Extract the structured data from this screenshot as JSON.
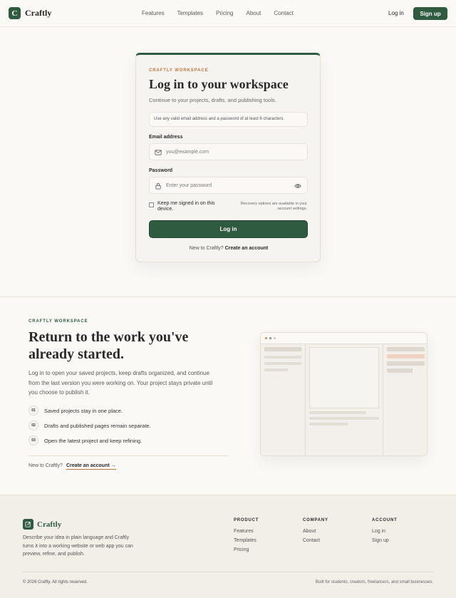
{
  "nav": {
    "logo_letter": "C",
    "brand": "Craftly",
    "links": [
      "Features",
      "Templates",
      "Pricing",
      "About",
      "Contact"
    ],
    "login": "Log in",
    "signup": "Sign up"
  },
  "login_card": {
    "eyebrow": "CRAFTLY WORKSPACE",
    "title": "Log in to your workspace",
    "subtitle": "Continue to your projects, drafts, and publishing tools.",
    "hint": "Use any valid email address and a password of at least 6 characters.",
    "email_label": "Email address",
    "email_placeholder": "you@example.com",
    "password_label": "Password",
    "password_placeholder": "Enter your password",
    "remember_label": "Keep me signed in on this device.",
    "recovery_note": "Recovery options are available in your account settings.",
    "submit": "Log in",
    "new_prefix": "New to Craftly?",
    "create_link": "Create an account"
  },
  "section": {
    "eyebrow": "CRAFTLY WORKSPACE",
    "title": "Return to the work you've already started.",
    "body": "Log in to open your saved projects, keep drafts organized, and continue from the last version you were working on. Your project stays private until you choose to publish it.",
    "steps": [
      {
        "num": "01",
        "text": "Saved projects stay in one place."
      },
      {
        "num": "02",
        "text": "Drafts and published pages remain separate."
      },
      {
        "num": "03",
        "text": "Open the latest project and keep refining."
      }
    ],
    "new_prefix": "New to Craftly?",
    "create_link": "Create an account →"
  },
  "footer": {
    "brand": "Craftly",
    "description": "Describe your idea in plain language and Craftly turns it into a working website or web app you can preview, refine, and publish.",
    "columns": [
      {
        "heading": "PRODUCT",
        "links": [
          "Features",
          "Templates",
          "Pricing"
        ]
      },
      {
        "heading": "COMPANY",
        "links": [
          "About",
          "Contact"
        ]
      },
      {
        "heading": "ACCOUNT",
        "links": [
          "Log in",
          "Sign up"
        ]
      }
    ],
    "copyright": "© 2026 Craftly. All rights reserved.",
    "built_for": "Built for students, creators, freelancers, and small businesses."
  },
  "colors": {
    "brand_green": "#2f5b41",
    "accent_orange": "#c0743d",
    "background": "#faf9f6",
    "footer_bg": "#f2eee8"
  },
  "icons": {
    "email_field": "mail-icon",
    "password_field": "lock-icon",
    "password_toggle": "eye-icon",
    "footer_logo": "edit-icon"
  }
}
